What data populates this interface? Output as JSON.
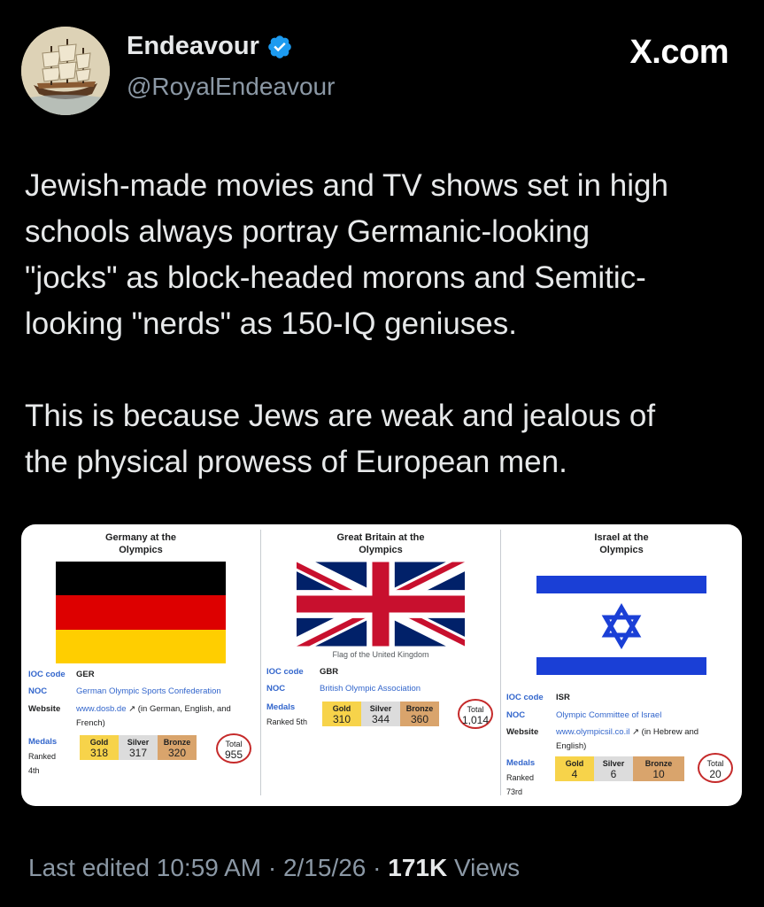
{
  "author": {
    "name": "Endeavour",
    "handle": "@RoyalEndeavour",
    "avatar_icon": "sailing-ship-avatar",
    "verified_icon": "verified-badge-icon",
    "verified_color": "#1d9bf0"
  },
  "watermark": "X.com",
  "tweet": {
    "paragraph1": "Jewish-made movies and TV shows set in high\nschools always portray Germanic-looking\n\"jocks\" as block-headed morons and Semitic-\nlooking \"nerds\" as 150-IQ geniuses.",
    "paragraph2": "This is because Jews are weak and jealous of\nthe physical prowess of European men."
  },
  "image": {
    "germany": {
      "title": "Germany at the\nOlympics",
      "ioc_label": "IOC code",
      "ioc_value": "GER",
      "noc_label": "NOC",
      "noc_value": "German Olympic Sports Confederation",
      "website_label": "Website",
      "website_link": "www.dosb.de",
      "website_note": "(in German, English, and",
      "website_note2": "French)",
      "medals_label": "Medals",
      "ranked_label": "Ranked",
      "rank": "4th",
      "gold_label": "Gold",
      "gold": "318",
      "silver_label": "Silver",
      "silver": "317",
      "bronze_label": "Bronze",
      "bronze": "320",
      "total_label": "Total",
      "total": "955"
    },
    "britain": {
      "title": "Great Britain at the\nOlympics",
      "caption": "Flag of the United Kingdom",
      "ioc_label": "IOC code",
      "ioc_value": "GBR",
      "noc_label": "NOC",
      "noc_value": "British Olympic Association",
      "medals_label": "Medals",
      "ranked_label": "Ranked 5th",
      "gold_label": "Gold",
      "gold": "310",
      "silver_label": "Silver",
      "silver": "344",
      "bronze_label": "Bronze",
      "bronze": "360",
      "total_label": "Total",
      "total": "1,014"
    },
    "israel": {
      "title": "Israel at the\nOlympics",
      "ioc_label": "IOC code",
      "ioc_value": "ISR",
      "noc_label": "NOC",
      "noc_value": "Olympic Committee of Israel",
      "website_label": "Website",
      "website_link": "www.olympicsil.co.il",
      "website_note": "(in Hebrew and",
      "website_note2": "English)",
      "medals_label": "Medals",
      "ranked_label": "Ranked",
      "rank": "73rd",
      "gold_label": "Gold",
      "gold": "4",
      "silver_label": "Silver",
      "silver": "6",
      "bronze_label": "Bronze",
      "bronze": "10",
      "total_label": "Total",
      "total": "20"
    }
  },
  "footer": {
    "edited": "Last edited 10:59 AM · 2/15/26 · ",
    "views_count": "171K",
    "views_label": " Views"
  }
}
